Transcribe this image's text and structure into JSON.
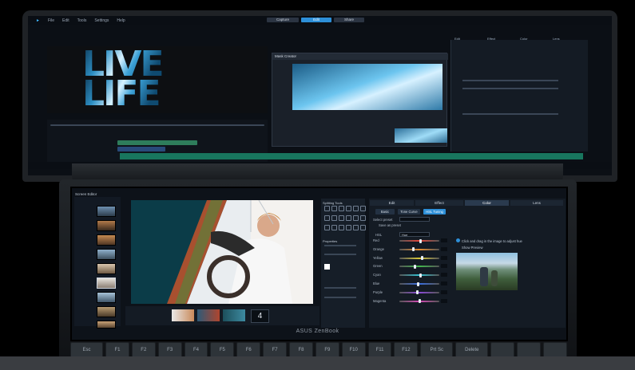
{
  "top_screen": {
    "menu": [
      "File",
      "Edit",
      "Tools",
      "Settings",
      "Help"
    ],
    "modes": [
      "Capture",
      "Edit",
      "Share"
    ],
    "active_mode": "Edit",
    "canvas_words": [
      "LIVE",
      "LIFE"
    ],
    "dialog_title": "Mask Creator",
    "right_tabs": [
      "Edit",
      "Effect",
      "Color",
      "Lens"
    ]
  },
  "bottom_screen": {
    "title": "Screen Editor",
    "main_tabs": [
      "Edit",
      "Effect",
      "Color",
      "Lens"
    ],
    "active_main_tab": "Color",
    "sub_tabs": [
      "Basic",
      "Tone Curve",
      "HSL Tuning"
    ],
    "active_sub_tab": "HSL Tuning",
    "select_preset_label": "Select preset",
    "save_preset_label": "Save as preset",
    "hsl_label": "HSL",
    "hsl_mode": "Hue",
    "sliders": [
      {
        "label": "Red",
        "value": 0.52,
        "color": "#e0443a"
      },
      {
        "label": "Orange",
        "value": 0.34,
        "color": "#e58a2e"
      },
      {
        "label": "Yellow",
        "value": 0.56,
        "color": "#d9c93a"
      },
      {
        "label": "Green",
        "value": 0.38,
        "color": "#41b84d"
      },
      {
        "label": "Cyan",
        "value": 0.52,
        "color": "#33c0d0"
      },
      {
        "label": "Blue",
        "value": 0.46,
        "color": "#3a6ee0"
      },
      {
        "label": "Purple",
        "value": 0.44,
        "color": "#8a4ad8"
      },
      {
        "label": "Magenta",
        "value": 0.5,
        "color": "#d24ab4"
      }
    ],
    "hint_drag": "Click and drag in the image to adjust hue",
    "hint_preview": "Show Preview",
    "tools_title": "Splitting Tools",
    "properties_title": "Properties",
    "film_count": "4"
  },
  "brand": "ASUS ZenBook",
  "keys": [
    "Esc",
    "F1",
    "F2",
    "F3",
    "F4",
    "F5",
    "F6",
    "F7",
    "F8",
    "F9",
    "F10",
    "F11",
    "F12",
    "Prt Sc",
    "Delete",
    "",
    "",
    ""
  ]
}
